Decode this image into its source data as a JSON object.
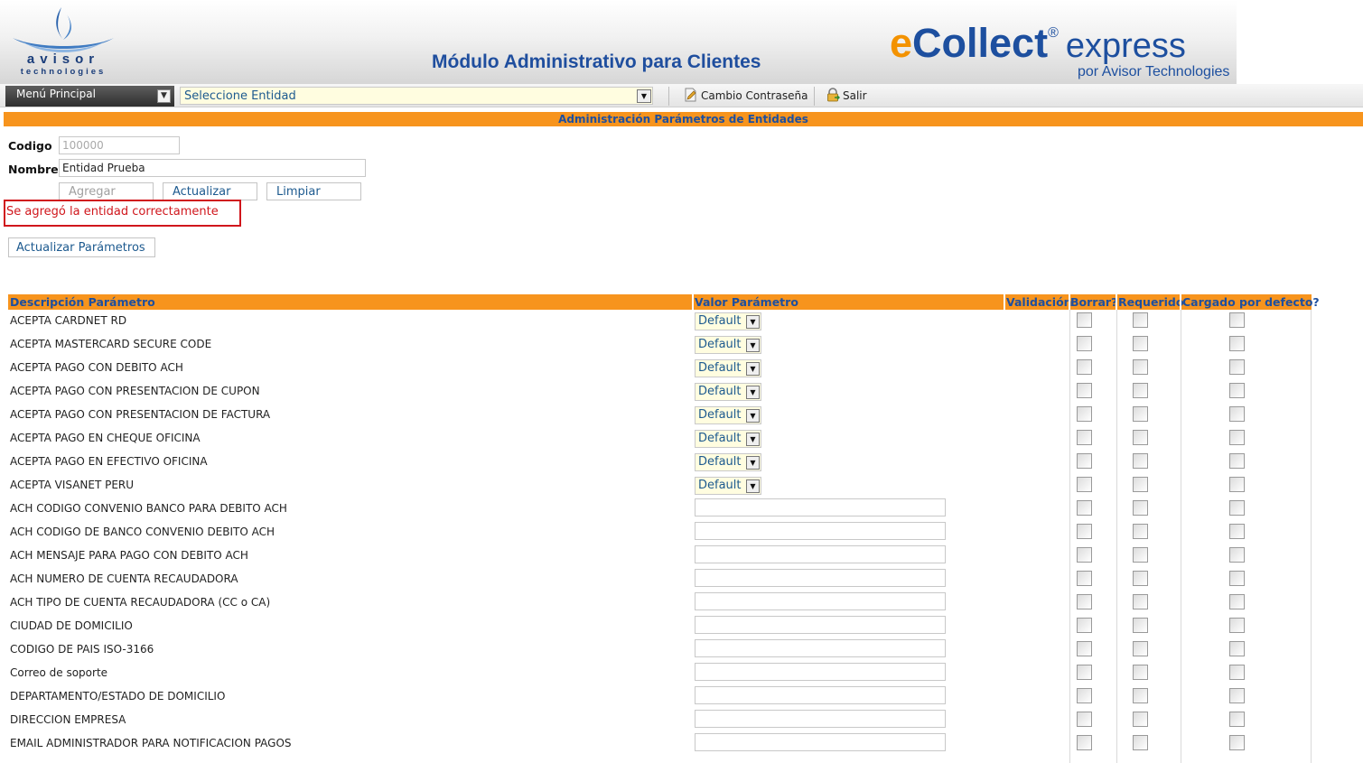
{
  "header": {
    "logo_name": "avisor",
    "logo_sub": "technologies",
    "page_heading": "Módulo Administrativo para Clientes",
    "brand_e": "e",
    "brand_collect": "Collect",
    "brand_reg": "®",
    "brand_express": "express",
    "brand_by": "por Avisor Technologies"
  },
  "toolbar": {
    "menu_label": "Menú Principal",
    "entity_select": "Seleccione Entidad",
    "change_password": "Cambio Contraseña",
    "exit": "Salir"
  },
  "section_title": "Administración Parámetros de Entidades",
  "form": {
    "codigo_label": "Codigo",
    "codigo_value": "100000",
    "nombre_label": "Nombre",
    "nombre_value": "Entidad Prueba",
    "btn_add": "Agregar",
    "btn_update": "Actualizar",
    "btn_clear": "Limpiar",
    "success_message": "Se agregó la entidad correctamente",
    "btn_update_params": "Actualizar Parámetros"
  },
  "table": {
    "columns": {
      "desc": "Descripción Parámetro",
      "value": "Valor Parámetro",
      "validation": "Validación",
      "delete": "Borrar?",
      "required": "Requerido",
      "default_loaded": "Cargado por defecto?"
    },
    "combo_default": "Default",
    "rows": [
      {
        "desc": "ACEPTA CARDNET RD",
        "type": "combo"
      },
      {
        "desc": "ACEPTA MASTERCARD SECURE CODE",
        "type": "combo"
      },
      {
        "desc": "ACEPTA PAGO CON DEBITO ACH",
        "type": "combo"
      },
      {
        "desc": "ACEPTA PAGO CON PRESENTACION DE CUPON",
        "type": "combo"
      },
      {
        "desc": "ACEPTA PAGO CON PRESENTACION DE FACTURA",
        "type": "combo"
      },
      {
        "desc": "ACEPTA PAGO EN CHEQUE OFICINA",
        "type": "combo"
      },
      {
        "desc": "ACEPTA PAGO EN EFECTIVO OFICINA",
        "type": "combo"
      },
      {
        "desc": "ACEPTA VISANET PERU",
        "type": "combo"
      },
      {
        "desc": "ACH CODIGO CONVENIO BANCO PARA DEBITO ACH",
        "type": "text"
      },
      {
        "desc": "ACH CODIGO DE BANCO CONVENIO DEBITO ACH",
        "type": "text"
      },
      {
        "desc": "ACH MENSAJE PARA PAGO CON DEBITO ACH",
        "type": "text"
      },
      {
        "desc": "ACH NUMERO DE CUENTA RECAUDADORA",
        "type": "text"
      },
      {
        "desc": "ACH TIPO DE CUENTA RECAUDADORA (CC o CA)",
        "type": "text"
      },
      {
        "desc": "CIUDAD DE DOMICILIO",
        "type": "text"
      },
      {
        "desc": "CODIGO DE PAIS ISO-3166",
        "type": "text"
      },
      {
        "desc": "Correo de soporte",
        "type": "text"
      },
      {
        "desc": "DEPARTAMENTO/ESTADO DE DOMICILIO",
        "type": "text"
      },
      {
        "desc": "DIRECCION EMPRESA",
        "type": "text"
      },
      {
        "desc": "EMAIL ADMINISTRADOR PARA NOTIFICACION PAGOS",
        "type": "text"
      }
    ]
  },
  "colors": {
    "orange": "#f7941d",
    "brand_blue": "#1d4f9f",
    "error_red": "#d0161c"
  }
}
